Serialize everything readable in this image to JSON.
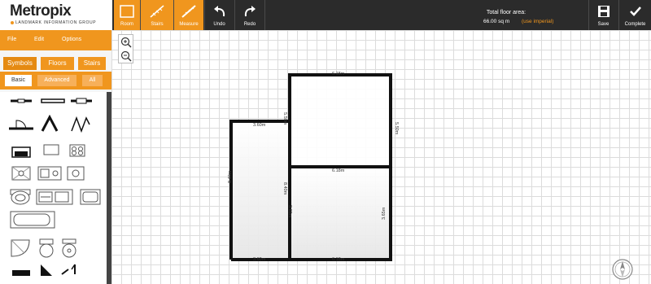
{
  "app": {
    "logo": "Metropix",
    "logo_subtitle": "LANDMARK INFORMATION GROUP"
  },
  "toolbar": {
    "tools": [
      {
        "id": "room",
        "label": "Room",
        "active": true
      },
      {
        "id": "stairs",
        "label": "Stairs",
        "active": true
      },
      {
        "id": "measure",
        "label": "Measure",
        "active": true
      }
    ],
    "undo_label": "Undo",
    "redo_label": "Redo",
    "save_label": "Save",
    "complete_label": "Complete"
  },
  "floor_area": {
    "label": "Total floor area:",
    "value": "66.00 sq m",
    "toggle_link": "(use imperial)"
  },
  "menu": {
    "file": "File",
    "edit": "Edit",
    "options": "Options"
  },
  "tabs": {
    "symbols": "Symbols",
    "floors": "Floors",
    "stairs": "Stairs"
  },
  "subtabs": {
    "basic": "Basic",
    "advanced": "Advanced",
    "all": "All"
  },
  "floorplan": {
    "dimensions": {
      "top_right_room": "6.18m",
      "right_upper": "5.50m",
      "mid_left_vertical": "5.50m",
      "left_room_top": "3.60m",
      "middle_wall": "6.18m",
      "left_room_left": "8.40m",
      "inner_wall_upper": "8.40m",
      "inner_wall_lower": "3.65m",
      "right_lower": "3.65m",
      "bottom_left": "3.60m",
      "bottom_right": "6.18m"
    }
  },
  "colors": {
    "accent": "#f0961e",
    "toolbar_bg": "#2b2b2b"
  }
}
